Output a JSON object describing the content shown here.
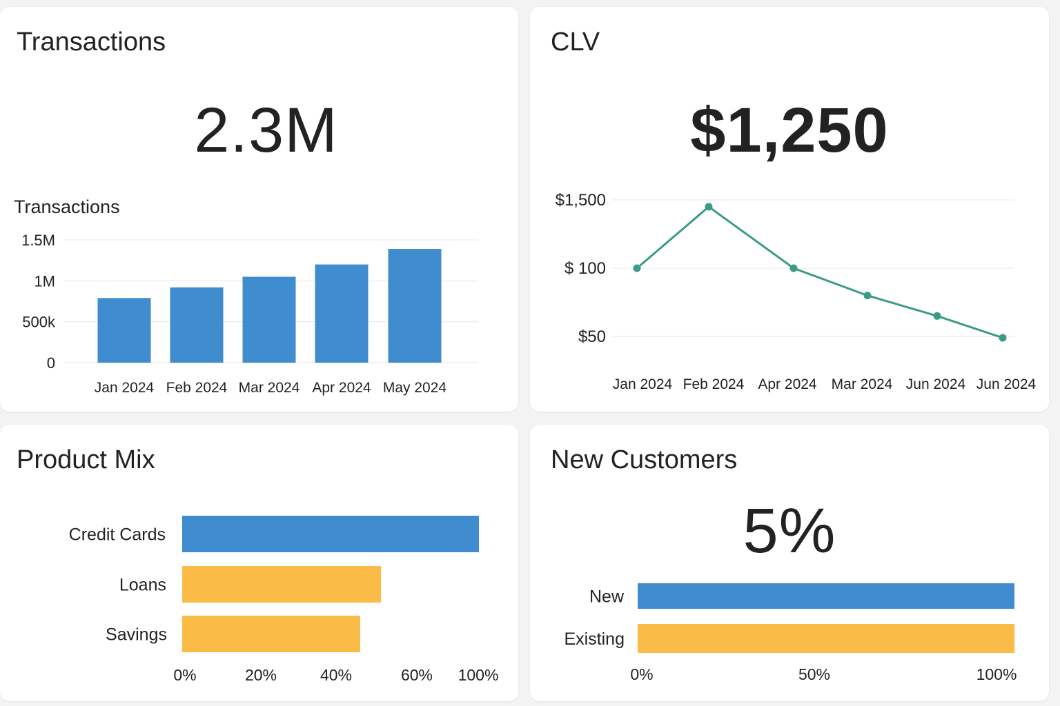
{
  "cards": {
    "transactions": {
      "title": "Transactions",
      "kpi": "2.3M"
    },
    "clv": {
      "title": "CLV",
      "kpi": "$1,250"
    },
    "product_mix": {
      "title": "Product Mix"
    },
    "new_customers": {
      "title": "New Customers",
      "kpi": "5%"
    }
  },
  "colors": {
    "blue": "#3f8ccf",
    "orange": "#fbbc47",
    "teal": "#3a9b86",
    "grid": "#e6e6e6"
  },
  "chart_data": [
    {
      "id": "transactions-bar",
      "type": "bar",
      "title": "Transactions",
      "categories": [
        "Jan 2024",
        "Feb 2024",
        "Mar 2024",
        "Apr 2024",
        "May 2024"
      ],
      "values": [
        790000,
        920000,
        1050000,
        1200000,
        1390000
      ],
      "yticks": [
        {
          "value": 0,
          "label": "0"
        },
        {
          "value": 500000,
          "label": "500k"
        },
        {
          "value": 1000000,
          "label": "1M"
        },
        {
          "value": 1500000,
          "label": "1.5M"
        }
      ],
      "ylim": [
        0,
        1500000
      ],
      "grid": true
    },
    {
      "id": "clv-line",
      "type": "line",
      "categories": [
        "Jan 2024",
        "Feb 2024",
        "Apr 2024",
        "Mar 2024",
        "Jun 2024",
        "Jun 2024"
      ],
      "values": [
        100,
        145,
        100,
        80,
        65,
        49
      ],
      "yticks": [
        {
          "value": 50,
          "label": "$50"
        },
        {
          "value": 100,
          "label": "$ 100"
        },
        {
          "value": 150,
          "label": "$1,500"
        }
      ],
      "ylim": [
        50,
        150
      ],
      "grid": true
    },
    {
      "id": "product-mix-hbar",
      "type": "bar",
      "orientation": "horizontal",
      "categories": [
        "Credit Cards",
        "Loans",
        "Savings"
      ],
      "values": [
        100,
        67,
        60
      ],
      "bar_colors": [
        "#3f8ccf",
        "#fbbc47",
        "#fbbc47"
      ],
      "xticks": [
        "0%",
        "20%",
        "40%",
        "60%",
        "100%"
      ],
      "xlim": [
        0,
        100
      ]
    },
    {
      "id": "new-customers-hbar",
      "type": "bar",
      "orientation": "horizontal",
      "categories": [
        "New",
        "Existing"
      ],
      "values": [
        100,
        100
      ],
      "bar_colors": [
        "#3f8ccf",
        "#fbbc47"
      ],
      "xticks": [
        "0%",
        "50%",
        "100%"
      ],
      "xlim": [
        0,
        100
      ]
    }
  ]
}
